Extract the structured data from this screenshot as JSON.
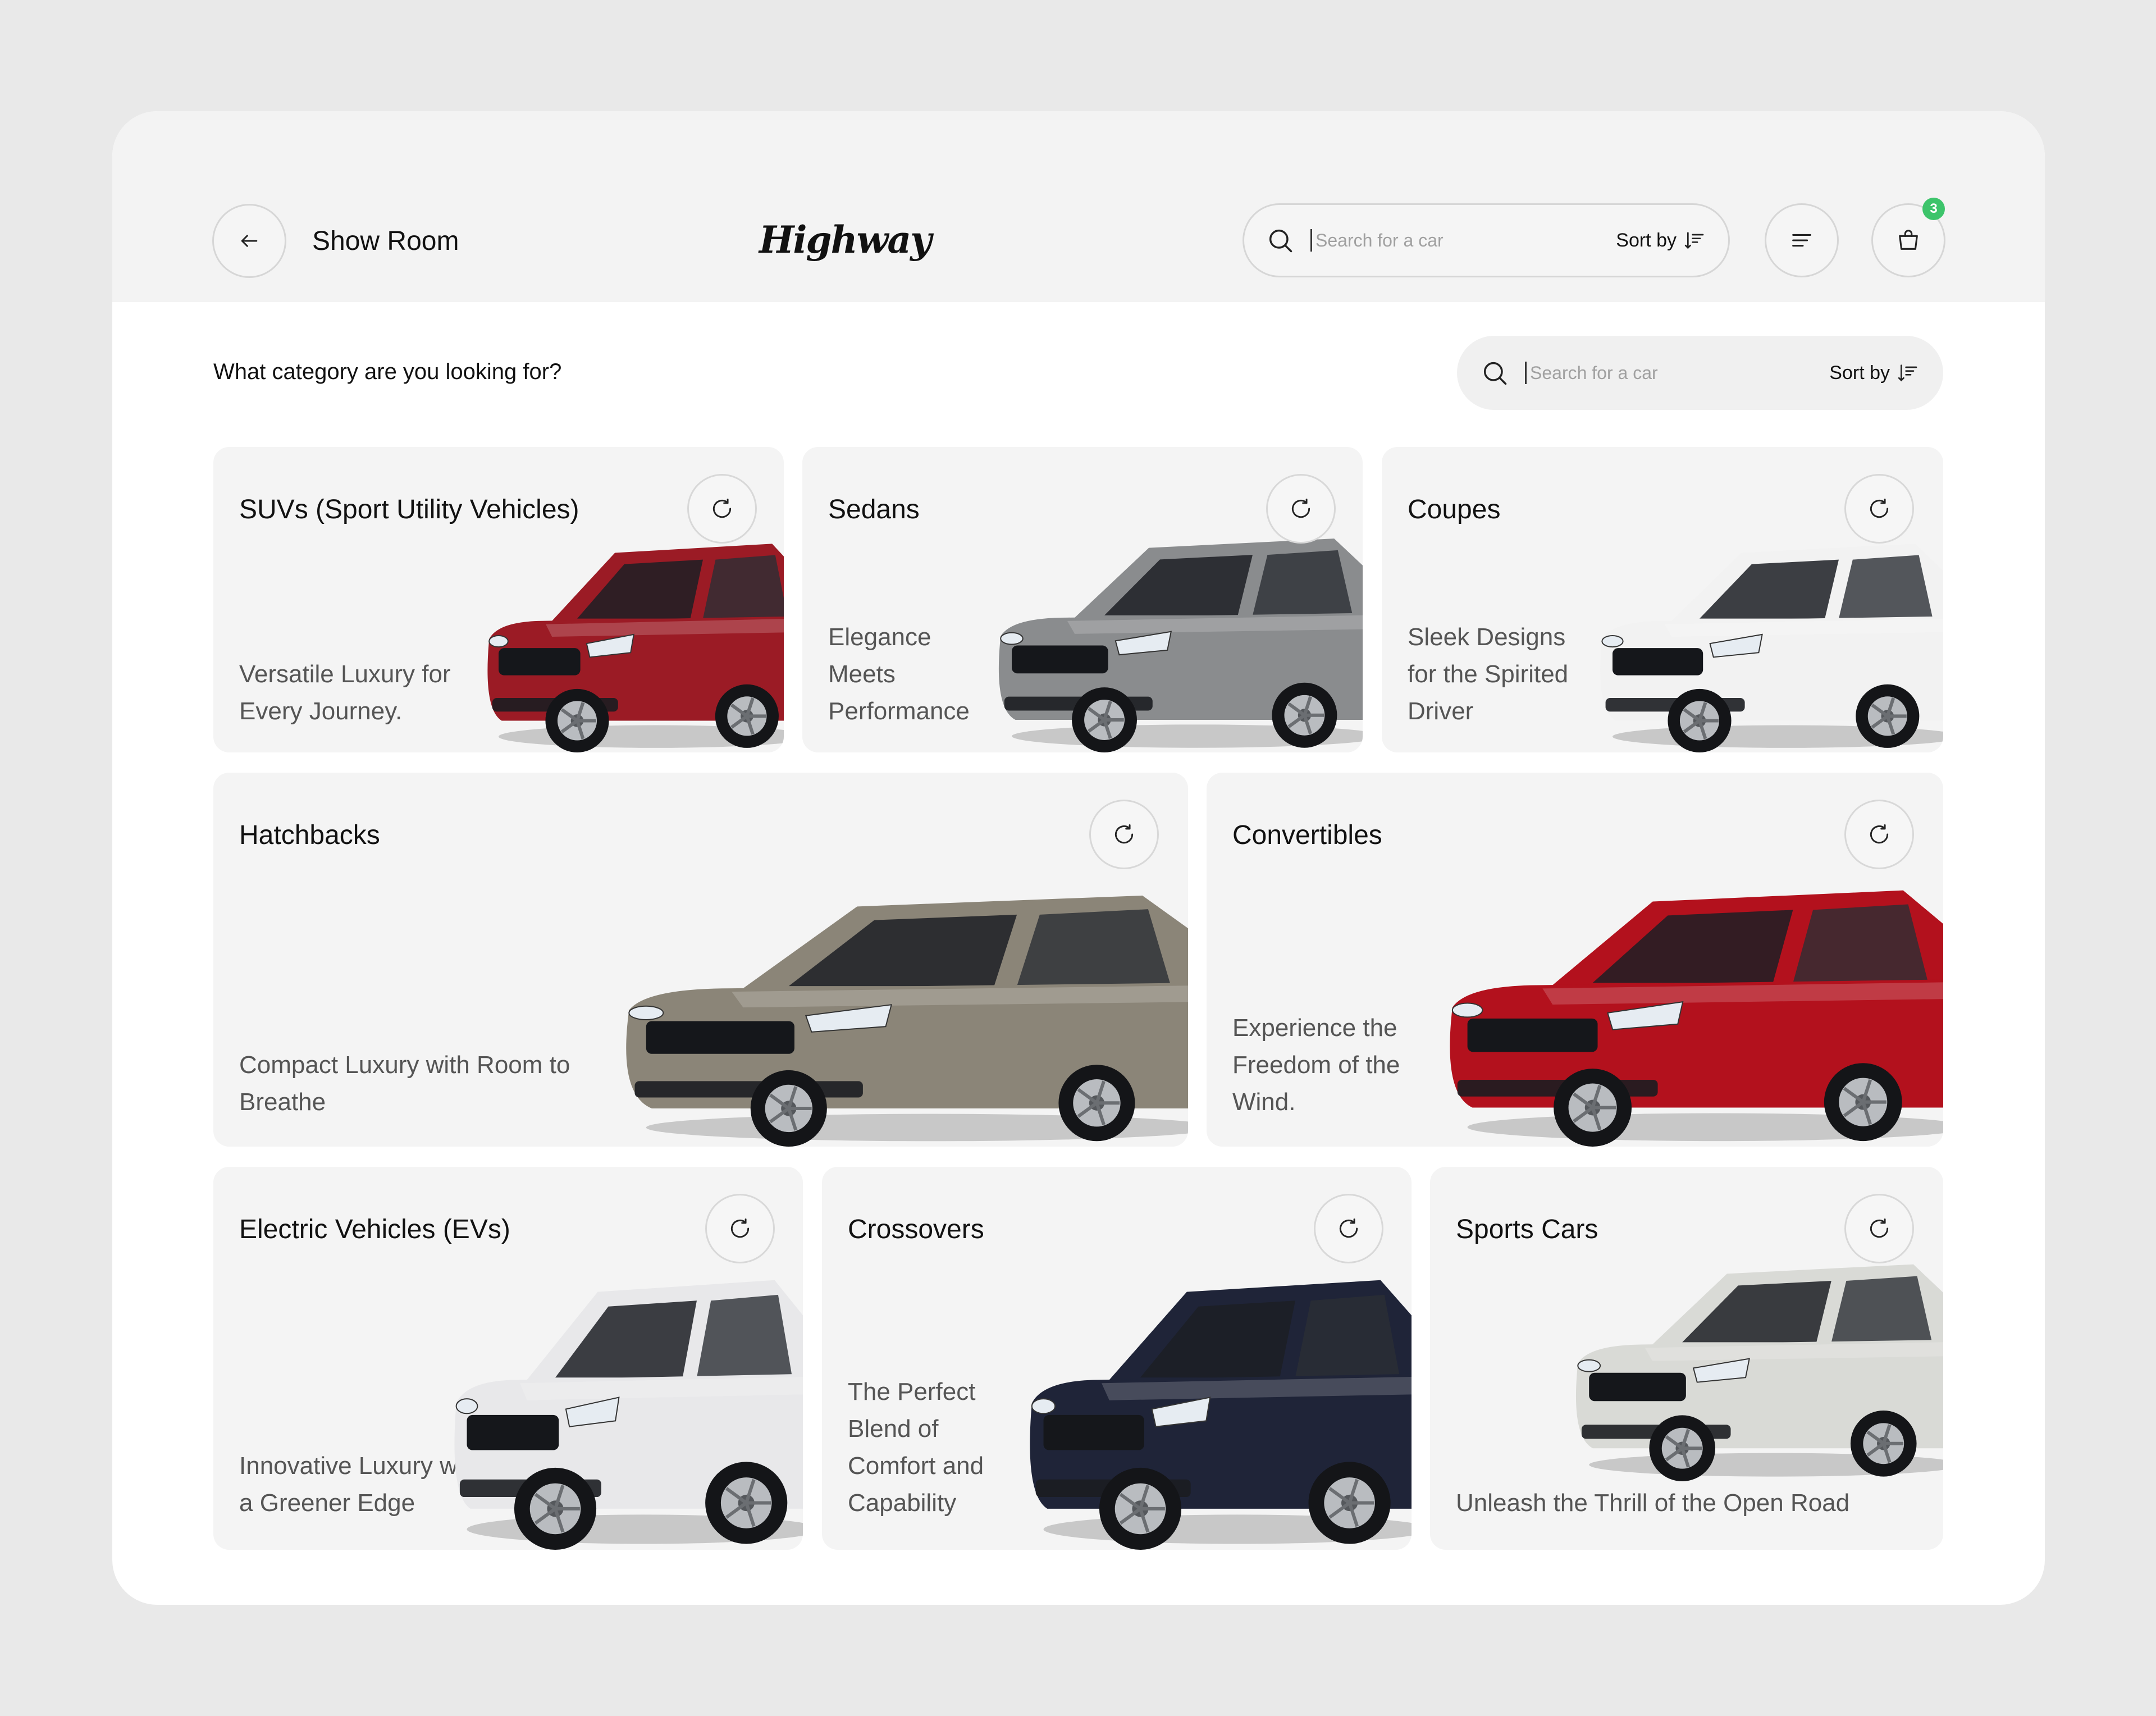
{
  "header": {
    "title": "Show Room",
    "logo": "Highway",
    "search_placeholder": "Search for a car",
    "sort_label": "Sort by",
    "cart_count": "3"
  },
  "section": {
    "question": "What category are you looking for?",
    "search_placeholder": "Search for a car",
    "sort_label": "Sort by"
  },
  "categories": [
    {
      "title": "SUVs (Sport Utility Vehicles)",
      "description": "Versatile Luxury for Every Journey.",
      "car_color": "#9b1b25"
    },
    {
      "title": "Sedans",
      "description": "Elegance Meets Performance",
      "car_color": "#8a8c8e"
    },
    {
      "title": "Coupes",
      "description": "Sleek Designs for the Spirited Driver",
      "car_color": "#f2f2f2"
    },
    {
      "title": "Hatchbacks",
      "description": "Compact Luxury with Room to Breathe",
      "car_color": "#8b8578"
    },
    {
      "title": "Convertibles",
      "description": "Experience the Freedom of the Wind.",
      "car_color": "#b3111d"
    },
    {
      "title": "Electric Vehicles (EVs)",
      "description": "Innovative Luxury with a Greener Edge",
      "car_color": "#e8e8ea"
    },
    {
      "title": "Crossovers",
      "description": "The Perfect Blend of Comfort and Capability",
      "car_color": "#1f2438"
    },
    {
      "title": "Sports Cars",
      "description": "Unleash the Thrill of the Open Road",
      "car_color": "#d9dad6"
    }
  ],
  "colors": {
    "background": "#e9e9e9",
    "panel": "#ffffff",
    "card": "#f4f4f4",
    "badge": "#3dc46b"
  },
  "icons": [
    "arrow-left-icon",
    "search-icon",
    "sort-icon",
    "menu-icon",
    "shopping-bag-icon",
    "refresh-icon"
  ]
}
